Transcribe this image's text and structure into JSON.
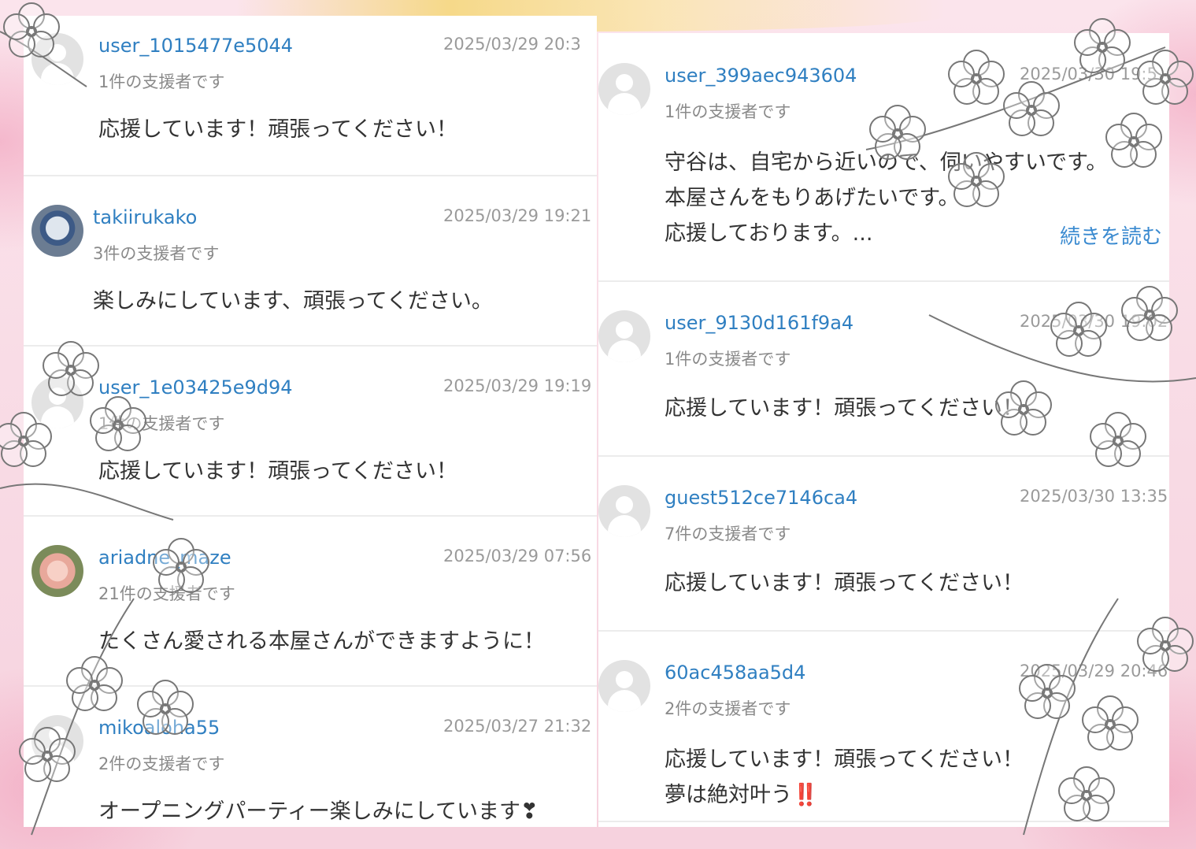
{
  "accent_color": "#2f7fc1",
  "comments_left": [
    {
      "username": "user_1015477e5044",
      "date": "2025/03/29 20:3",
      "supporters": "1件の支援者です",
      "message": [
        "応援しています！頑張ってください！"
      ],
      "avatar": "default-avatar-icon"
    },
    {
      "username": "takiirukako",
      "date": "2025/03/29 19:21",
      "supporters": "3件の支援者です",
      "message": [
        "楽しみにしています、頑張ってください。"
      ],
      "avatar": "photo-avatar"
    },
    {
      "username": "user_1e03425e9d94",
      "date": "2025/03/29 19:19",
      "supporters": "1件の支援者です",
      "message": [
        "応援しています！頑張ってください！"
      ],
      "avatar": "default-avatar-icon"
    },
    {
      "username": "ariadne_maze",
      "date": "2025/03/29 07:56",
      "supporters": "21件の支援者です",
      "message": [
        "たくさん愛される本屋さんができますように！"
      ],
      "avatar": "photo-avatar"
    },
    {
      "username": "mikoaloha55",
      "date": "2025/03/27 21:32",
      "supporters": "2件の支援者です",
      "message": [
        "オープニングパーティー楽しみにしています❣"
      ],
      "avatar": "default-avatar-icon"
    }
  ],
  "comments_right": [
    {
      "username": "user_399aec943604",
      "date": "2025/03/30 19:5",
      "supporters": "1件の支援者です",
      "message": [
        "守谷は、自宅から近いので、伺いやすいです。",
        "本屋さんをもりあげたいです。",
        "応援しております。..."
      ],
      "read_more": "続きを読む",
      "avatar": "default-avatar-icon"
    },
    {
      "username": "user_9130d161f9a4",
      "date": "2025/03/30 19:02",
      "supporters": "1件の支援者です",
      "message": [
        "応援しています！頑張ってください！"
      ],
      "avatar": "default-avatar-icon"
    },
    {
      "username": "guest512ce7146ca4",
      "date": "2025/03/30 13:35",
      "supporters": "7件の支援者です",
      "message": [
        "応援しています！頑張ってください！"
      ],
      "avatar": "default-avatar-icon"
    },
    {
      "username": "60ac458aa5d4",
      "date": "2025/03/29 20:46",
      "supporters": "2件の支援者です",
      "message": [
        "応援しています！頑張ってください！",
        "夢は絶対叶う‼️"
      ],
      "avatar": "default-avatar-icon"
    }
  ]
}
